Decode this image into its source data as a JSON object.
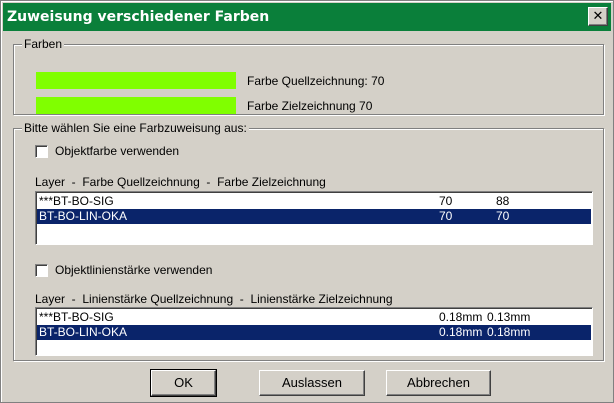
{
  "window": {
    "title": "Zuweisung verschiedener Farben",
    "close_label": "✕"
  },
  "colors_group": {
    "legend": "Farben",
    "source_color_label": "Farbe Quellzeichnung: 70",
    "target_color_label": "Farbe Zielzeichnung 70",
    "swatch_color": "#80ff00"
  },
  "assignment_group": {
    "legend": "Bitte wählen Sie eine Farbzuweisung aus:",
    "object_color_checkbox": {
      "label": "Objektfarbe verwenden",
      "checked": false
    },
    "color_list": {
      "header": "Layer  -  Farbe Quellzeichnung  -  Farbe Zielzeichnung",
      "rows": [
        {
          "layer": "***BT-BO-SIG",
          "source": "70",
          "target": "88",
          "selected": false
        },
        {
          "layer": "BT-BO-LIN-OKA",
          "source": "70",
          "target": "70",
          "selected": true
        }
      ]
    },
    "object_lineweight_checkbox": {
      "label": "Objektlinienstärke verwenden",
      "checked": false
    },
    "lineweight_list": {
      "header": "Layer  -  Linienstärke Quellzeichnung  -  Linienstärke Zielzeichnung",
      "rows": [
        {
          "layer": "***BT-BO-SIG",
          "source": "0.18mm",
          "target": "0.13mm",
          "selected": false
        },
        {
          "layer": "BT-BO-LIN-OKA",
          "source": "0.18mm",
          "target": "0.18mm",
          "selected": true
        }
      ]
    }
  },
  "buttons": {
    "ok": "OK",
    "skip": "Auslassen",
    "cancel": "Abbrechen"
  }
}
